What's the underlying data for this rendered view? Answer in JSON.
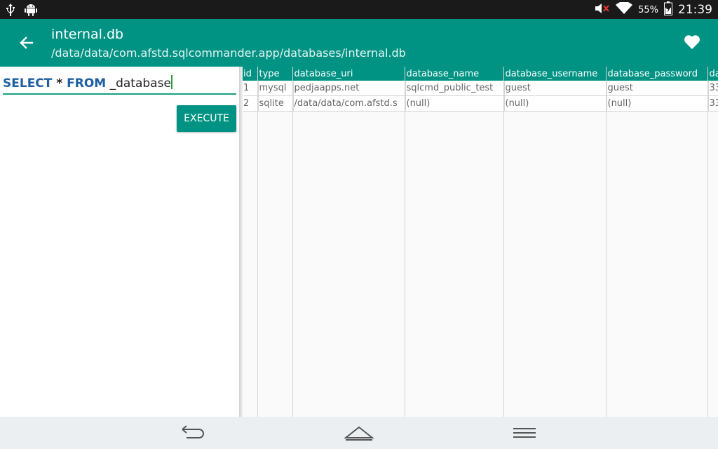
{
  "status_bar": {
    "icons": [
      "usb-icon",
      "android-icon",
      "mute-icon",
      "wifi-icon",
      "battery-icon"
    ],
    "battery_percent": "55%",
    "clock": "21:39"
  },
  "app_bar": {
    "title": "internal.db",
    "subtitle": "/data/data/com.afstd.sqlcommander.app/databases/internal.db",
    "color": "#009384"
  },
  "query": {
    "select_kw": "SELECT",
    "star": " * ",
    "from_kw": "FROM",
    "table_name": " _database"
  },
  "execute_button": {
    "label": "EXECUTE"
  },
  "results": {
    "columns": [
      "id",
      "type",
      "database_uri",
      "database_name",
      "database_username",
      "database_password",
      "da"
    ],
    "rows": [
      [
        "1",
        "mysql",
        "pedjaapps.net",
        "sqlcmd_public_test",
        "guest",
        "guest",
        "33"
      ],
      [
        "2",
        "sqlite",
        "/data/data/com.afstd.s",
        "(null)",
        "(null)",
        "(null)",
        "33"
      ]
    ]
  },
  "nav_bar": {
    "icons": [
      "back-nav-icon",
      "home-nav-icon",
      "menu-nav-icon"
    ]
  }
}
